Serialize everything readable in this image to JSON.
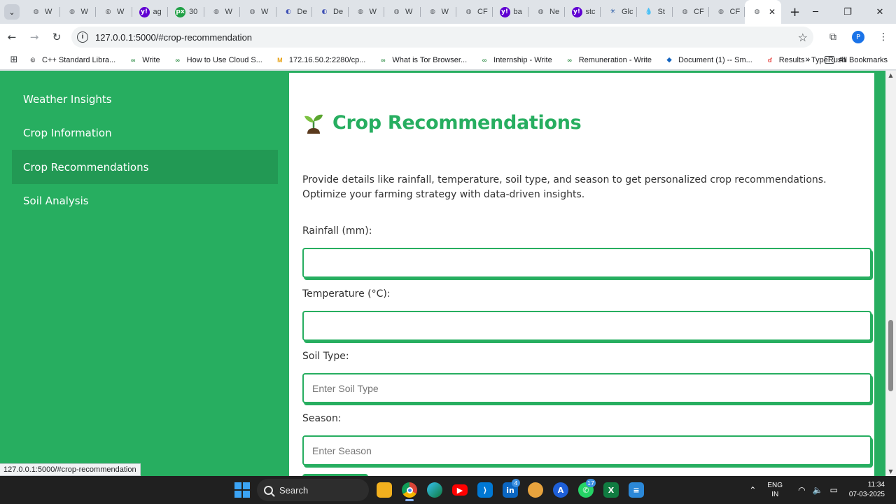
{
  "browser": {
    "tab_favicons": [
      {
        "glyph": "◍",
        "title": "W",
        "color": "#5f6368",
        "bg": "transparent"
      },
      {
        "glyph": "◍",
        "title": "W",
        "color": "#5f6368",
        "bg": "transparent"
      },
      {
        "glyph": "◎",
        "title": "W",
        "color": "#202124",
        "bg": "transparent"
      },
      {
        "glyph": "y!",
        "title": "ag",
        "color": "#ffffff",
        "bg": "#6001d2"
      },
      {
        "glyph": "px",
        "title": "30",
        "color": "#ffffff",
        "bg": "#1fa045"
      },
      {
        "glyph": "◍",
        "title": "W",
        "color": "#5f6368",
        "bg": "transparent"
      },
      {
        "glyph": "◍",
        "title": "W",
        "color": "#5f6368",
        "bg": "transparent"
      },
      {
        "glyph": "◐",
        "title": "De",
        "color": "#3f51b5",
        "bg": "transparent"
      },
      {
        "glyph": "◐",
        "title": "De",
        "color": "#3f51b5",
        "bg": "transparent"
      },
      {
        "glyph": "◍",
        "title": "W",
        "color": "#5f6368",
        "bg": "transparent"
      },
      {
        "glyph": "◍",
        "title": "W",
        "color": "#5f6368",
        "bg": "transparent"
      },
      {
        "glyph": "◍",
        "title": "W",
        "color": "#5f6368",
        "bg": "transparent"
      },
      {
        "glyph": "◍",
        "title": "CF",
        "color": "#5f6368",
        "bg": "transparent"
      },
      {
        "glyph": "y!",
        "title": "ba",
        "color": "#ffffff",
        "bg": "#6001d2"
      },
      {
        "glyph": "◍",
        "title": "Ne",
        "color": "#5f6368",
        "bg": "transparent"
      },
      {
        "glyph": "y!",
        "title": "stc",
        "color": "#ffffff",
        "bg": "#6001d2"
      },
      {
        "glyph": "✳",
        "title": "Glc",
        "color": "#1a4fa0",
        "bg": "transparent"
      },
      {
        "glyph": "💧",
        "title": "St",
        "color": "#5f6368",
        "bg": "transparent"
      },
      {
        "glyph": "◍",
        "title": "CF",
        "color": "#5f6368",
        "bg": "transparent"
      },
      {
        "glyph": "◍",
        "title": "CF",
        "color": "#5f6368",
        "bg": "transparent"
      }
    ],
    "active_tab_glyph": "◍",
    "url": "127.0.0.1:5000/#crop-recommendation",
    "bookmarks": [
      {
        "label": "C++ Standard Libra...",
        "icon": "©",
        "color": "#202124"
      },
      {
        "label": "Write",
        "icon": "∞",
        "color": "#2f8d46"
      },
      {
        "label": "How to Use Cloud S...",
        "icon": "∞",
        "color": "#2f8d46"
      },
      {
        "label": "172.16.50.2:2280/cp...",
        "icon": "M",
        "color": "#e8a317"
      },
      {
        "label": "What is Tor Browser...",
        "icon": "∞",
        "color": "#2f8d46"
      },
      {
        "label": "Internship - Write",
        "icon": "∞",
        "color": "#2f8d46"
      },
      {
        "label": "Remuneration - Write",
        "icon": "∞",
        "color": "#2f8d46"
      },
      {
        "label": "Document (1) -- Sm...",
        "icon": "◆",
        "color": "#1565c0"
      },
      {
        "label": "Results - TypeRush",
        "icon": "ɗ",
        "color": "#e53935"
      }
    ],
    "all_bookmarks": "All Bookmarks",
    "profile_initial": "P",
    "status_url": "127.0.0.1:5000/#crop-recommendation"
  },
  "sidebar": {
    "items": [
      {
        "label": "Weather Insights",
        "active": false
      },
      {
        "label": "Crop Information",
        "active": false
      },
      {
        "label": "Crop Recommendations",
        "active": true
      },
      {
        "label": "Soil Analysis",
        "active": false
      }
    ]
  },
  "main": {
    "title": "Crop Recommendations",
    "description": "Provide details like rainfall, temperature, soil type, and season to get personalized crop recommendations. Optimize your farming strategy with data-driven insights.",
    "fields": [
      {
        "label": "Rainfall (mm):",
        "placeholder": "",
        "value": ""
      },
      {
        "label": "Temperature (°C):",
        "placeholder": "",
        "value": ""
      },
      {
        "label": "Soil Type:",
        "placeholder": "Enter Soil Type",
        "value": ""
      },
      {
        "label": "Season:",
        "placeholder": "Enter Season",
        "value": ""
      }
    ]
  },
  "taskbar": {
    "search_label": "Search",
    "linkedin_badge": "4",
    "whatsapp_badge": "17",
    "lang_top": "ENG",
    "lang_bottom": "IN",
    "time": "11:34",
    "date": "07-03-2025"
  },
  "colors": {
    "brand_green": "#27ae60",
    "active_green": "#229954"
  }
}
